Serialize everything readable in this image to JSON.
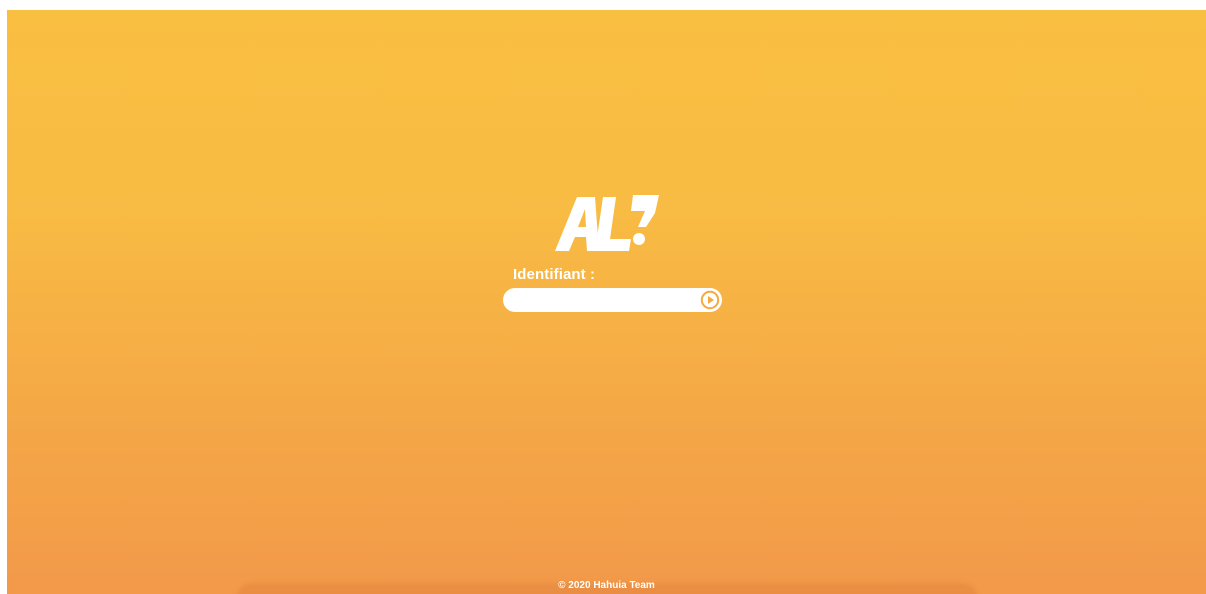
{
  "brand": {
    "logo_text": "AL?",
    "colors": {
      "background_top": "#f9bf41",
      "background_bottom": "#f2994a",
      "foreground": "#ffffff"
    }
  },
  "login": {
    "identifier_label": "Identifiant :",
    "identifier_value": "",
    "identifier_placeholder": "",
    "submit_icon": "play-circle-icon"
  },
  "footer": {
    "copyright": "© 2020 Hahuia Team"
  }
}
